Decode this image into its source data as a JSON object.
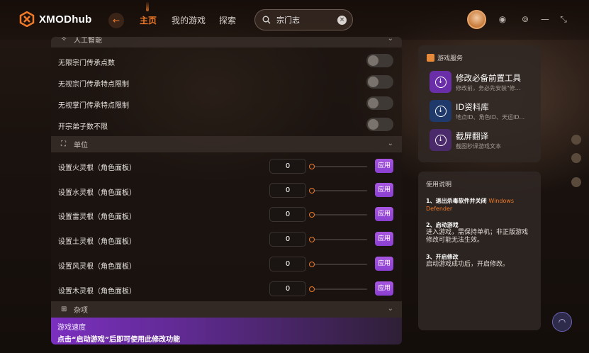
{
  "app": {
    "name": "XMODhub"
  },
  "colors": {
    "accent": "#f07a2a",
    "apply": "#9a4bdc"
  },
  "nav": {
    "back_icon": "arrow-left-icon",
    "items": [
      {
        "label": "主页",
        "active": true
      },
      {
        "label": "我的游戏",
        "active": false
      },
      {
        "label": "探索",
        "active": false
      }
    ]
  },
  "search": {
    "value": "宗门志",
    "icon": "search-icon",
    "clear_icon": "close-icon"
  },
  "window_controls": {
    "icons": [
      "notification-icon",
      "settings-icon",
      "minimize-icon",
      "shrink-icon"
    ]
  },
  "main": {
    "section_ai": {
      "label": "人工智能"
    },
    "toggles": [
      {
        "label": "无限宗门传承点数",
        "on": false
      },
      {
        "label": "无视宗门传承特点限制",
        "on": false
      },
      {
        "label": "无视掌门传承特点限制",
        "on": false
      },
      {
        "label": "开宗弟子数不限",
        "on": false
      }
    ],
    "section_unit": {
      "label": "单位"
    },
    "sliders": [
      {
        "label": "设置火灵根（角色面板）",
        "value": "0",
        "apply": "应用"
      },
      {
        "label": "设置水灵根（角色面板）",
        "value": "0",
        "apply": "应用"
      },
      {
        "label": "设置雷灵根（角色面板）",
        "value": "0",
        "apply": "应用"
      },
      {
        "label": "设置土灵根（角色面板）",
        "value": "0",
        "apply": "应用"
      },
      {
        "label": "设置风灵根（角色面板）",
        "value": "0",
        "apply": "应用"
      },
      {
        "label": "设置木灵根（角色面板）",
        "value": "0",
        "apply": "应用"
      }
    ],
    "section_misc": {
      "label": "杂项"
    },
    "speed": {
      "title": "游戏速度",
      "subtitle": "点击“启动游戏”后即可使用此修改功能"
    }
  },
  "services": {
    "title": "游戏服务",
    "items": [
      {
        "name": "修改必备前置工具",
        "desc": "修改前，务必先安装\"修..."
      },
      {
        "name": "ID资料库",
        "desc": "地点ID、角色ID、天运ID..."
      },
      {
        "name": "截屏翻译",
        "desc": "截图秒译游戏文本"
      }
    ]
  },
  "usage": {
    "title": "使用说明",
    "steps": [
      {
        "title": "1、退出杀毒软件并关闭",
        "highlight": "Windows Defender",
        "body": ""
      },
      {
        "title": "2、启动游戏",
        "highlight": "",
        "body": "进入游戏，需保持单机；非正版游戏修改可能无法生效。"
      },
      {
        "title": "3、开启修改",
        "highlight": "",
        "body": "启动游戏成功后，开启修改。"
      }
    ]
  }
}
